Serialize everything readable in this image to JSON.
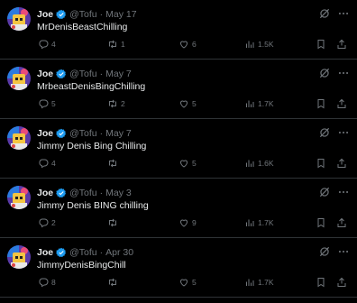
{
  "colors": {
    "background": "#000000",
    "text": "#e7e9ea",
    "muted": "#71767b",
    "verified": "#1d9bf0",
    "divider": "#2f3336"
  },
  "tweets": [
    {
      "name": "Joe",
      "handle": "@Tofu",
      "separator": "·",
      "date": "May 17",
      "text": "MrDenisBeastChilling",
      "replies": "4",
      "retweets": "1",
      "likes": "6",
      "views": "1.5K"
    },
    {
      "name": "Joe",
      "handle": "@Tofu",
      "separator": "·",
      "date": "May 7",
      "text": "MrbeastDenisBingChilling",
      "replies": "5",
      "retweets": "2",
      "likes": "5",
      "views": "1.7K"
    },
    {
      "name": "Joe",
      "handle": "@Tofu",
      "separator": "·",
      "date": "May 7",
      "text": "Jimmy Denis Bing Chilling",
      "replies": "4",
      "retweets": "",
      "likes": "5",
      "views": "1.6K"
    },
    {
      "name": "Joe",
      "handle": "@Tofu",
      "separator": "·",
      "date": "May 3",
      "text": "Jimmy Denis BING chilling",
      "replies": "2",
      "retweets": "",
      "likes": "9",
      "views": "1.7K"
    },
    {
      "name": "Joe",
      "handle": "@Tofu",
      "separator": "·",
      "date": "Apr 30",
      "text": "JimmyDenisBingChill",
      "replies": "8",
      "retweets": "",
      "likes": "5",
      "views": "1.7K"
    }
  ],
  "icons": {
    "verified": "verified-badge-icon",
    "grok": "grok-icon",
    "more": "more-icon",
    "reply": "reply-icon",
    "retweet": "retweet-icon",
    "like": "heart-icon",
    "views": "views-icon",
    "bookmark": "bookmark-icon",
    "share": "share-icon"
  }
}
